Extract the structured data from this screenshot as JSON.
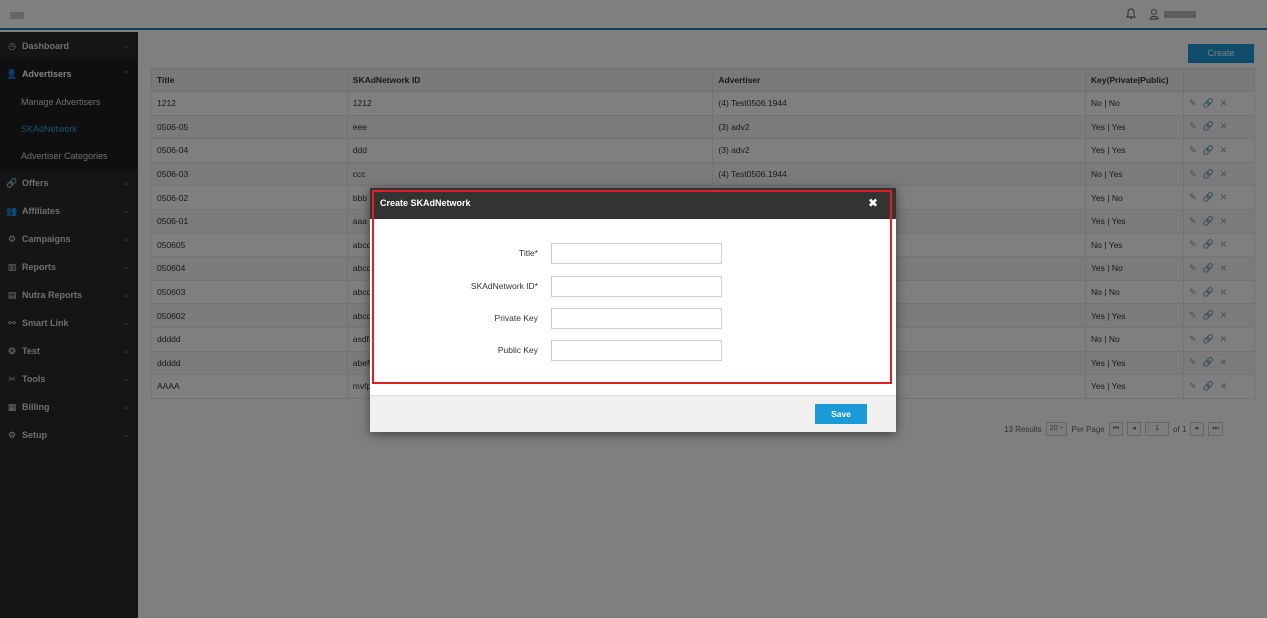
{
  "sidebar": {
    "items": [
      {
        "label": "Dashboard",
        "icon": "dashboard-icon",
        "glyph": "◷",
        "chev": "⌄"
      },
      {
        "label": "Advertisers",
        "icon": "user-icon",
        "glyph": "👤",
        "chev": "⌃"
      },
      {
        "label": "Offers",
        "icon": "link-icon",
        "glyph": "🔗",
        "chev": "⌄"
      },
      {
        "label": "Affiliates",
        "icon": "users-icon",
        "glyph": "👥",
        "chev": "⌄"
      },
      {
        "label": "Campaigns",
        "icon": "campaigns-icon",
        "glyph": "⚙",
        "chev": "⌄"
      },
      {
        "label": "Reports",
        "icon": "bar-chart-icon",
        "glyph": "▥",
        "chev": "⌄"
      },
      {
        "label": "Nutra Reports",
        "icon": "report-icon",
        "glyph": "▤",
        "chev": "⌄"
      },
      {
        "label": "Smart Link",
        "icon": "smart-link-icon",
        "glyph": "⚯",
        "chev": "⌄"
      },
      {
        "label": "Test",
        "icon": "test-icon",
        "glyph": "❂",
        "chev": "⌄"
      },
      {
        "label": "Tools",
        "icon": "tools-icon",
        "glyph": "✂",
        "chev": "⌄"
      },
      {
        "label": "Billing",
        "icon": "billing-icon",
        "glyph": "▦",
        "chev": "⌄"
      },
      {
        "label": "Setup",
        "icon": "setup-icon",
        "glyph": "⚙",
        "chev": "⌄"
      }
    ],
    "subitems": [
      "Manage Advertisers",
      "SKAdNetwork",
      "Advertiser Categories"
    ]
  },
  "toolbar": {
    "create_label": "Create"
  },
  "table": {
    "headers": [
      "Title",
      "SKAdNetwork ID",
      "Advertiser",
      "Key(Private|Public)",
      ""
    ],
    "rows": [
      [
        "1212",
        "1212",
        "(4) Test0506.1944",
        "No | No"
      ],
      [
        "0506-05",
        "eee",
        "(3) adv2",
        "Yes | Yes"
      ],
      [
        "0506-04",
        "ddd",
        "(3) adv2",
        "Yes | Yes"
      ],
      [
        "0506-03",
        "ccc",
        "(4) Test0506.1944",
        "No | Yes"
      ],
      [
        "0506-02",
        "bbb",
        "",
        "Yes | No"
      ],
      [
        "0506-01",
        "aaa",
        "",
        "Yes | Yes"
      ],
      [
        "050605",
        "abcd",
        "",
        "No | Yes"
      ],
      [
        "050604",
        "abcd",
        "",
        "Yes | No"
      ],
      [
        "050603",
        "abcd",
        "",
        "No | No"
      ],
      [
        "050602",
        "abcd",
        "",
        "Yes | Yes"
      ],
      [
        "ddddd",
        "asdfa",
        "",
        "No | No"
      ],
      [
        "ddddd",
        "abeff",
        "",
        "Yes | Yes"
      ],
      [
        "AAAA",
        "mvfpl",
        "",
        "Yes | Yes"
      ]
    ],
    "actions": "✎ 🔗 ✕"
  },
  "pager": {
    "results": "13 Results",
    "per_page_value": "20 ÷",
    "per_page_label": "Per Page",
    "first": "⏮",
    "prev": "◂",
    "page": "1",
    "of": "of 1",
    "next": "▸",
    "last": "⏭"
  },
  "modal": {
    "title": "Create SKAdNetwork",
    "close": "✖",
    "fields": [
      {
        "label": "Title*",
        "value": ""
      },
      {
        "label": "SKAdNetwork ID*",
        "value": ""
      },
      {
        "label": "Private Key",
        "value": ""
      },
      {
        "label": "Public Key",
        "value": ""
      }
    ],
    "save_label": "Save"
  },
  "colors": {
    "accent": "#1a9ad6",
    "highlight": "#e02020",
    "sidebar": "#2b2b2b"
  }
}
